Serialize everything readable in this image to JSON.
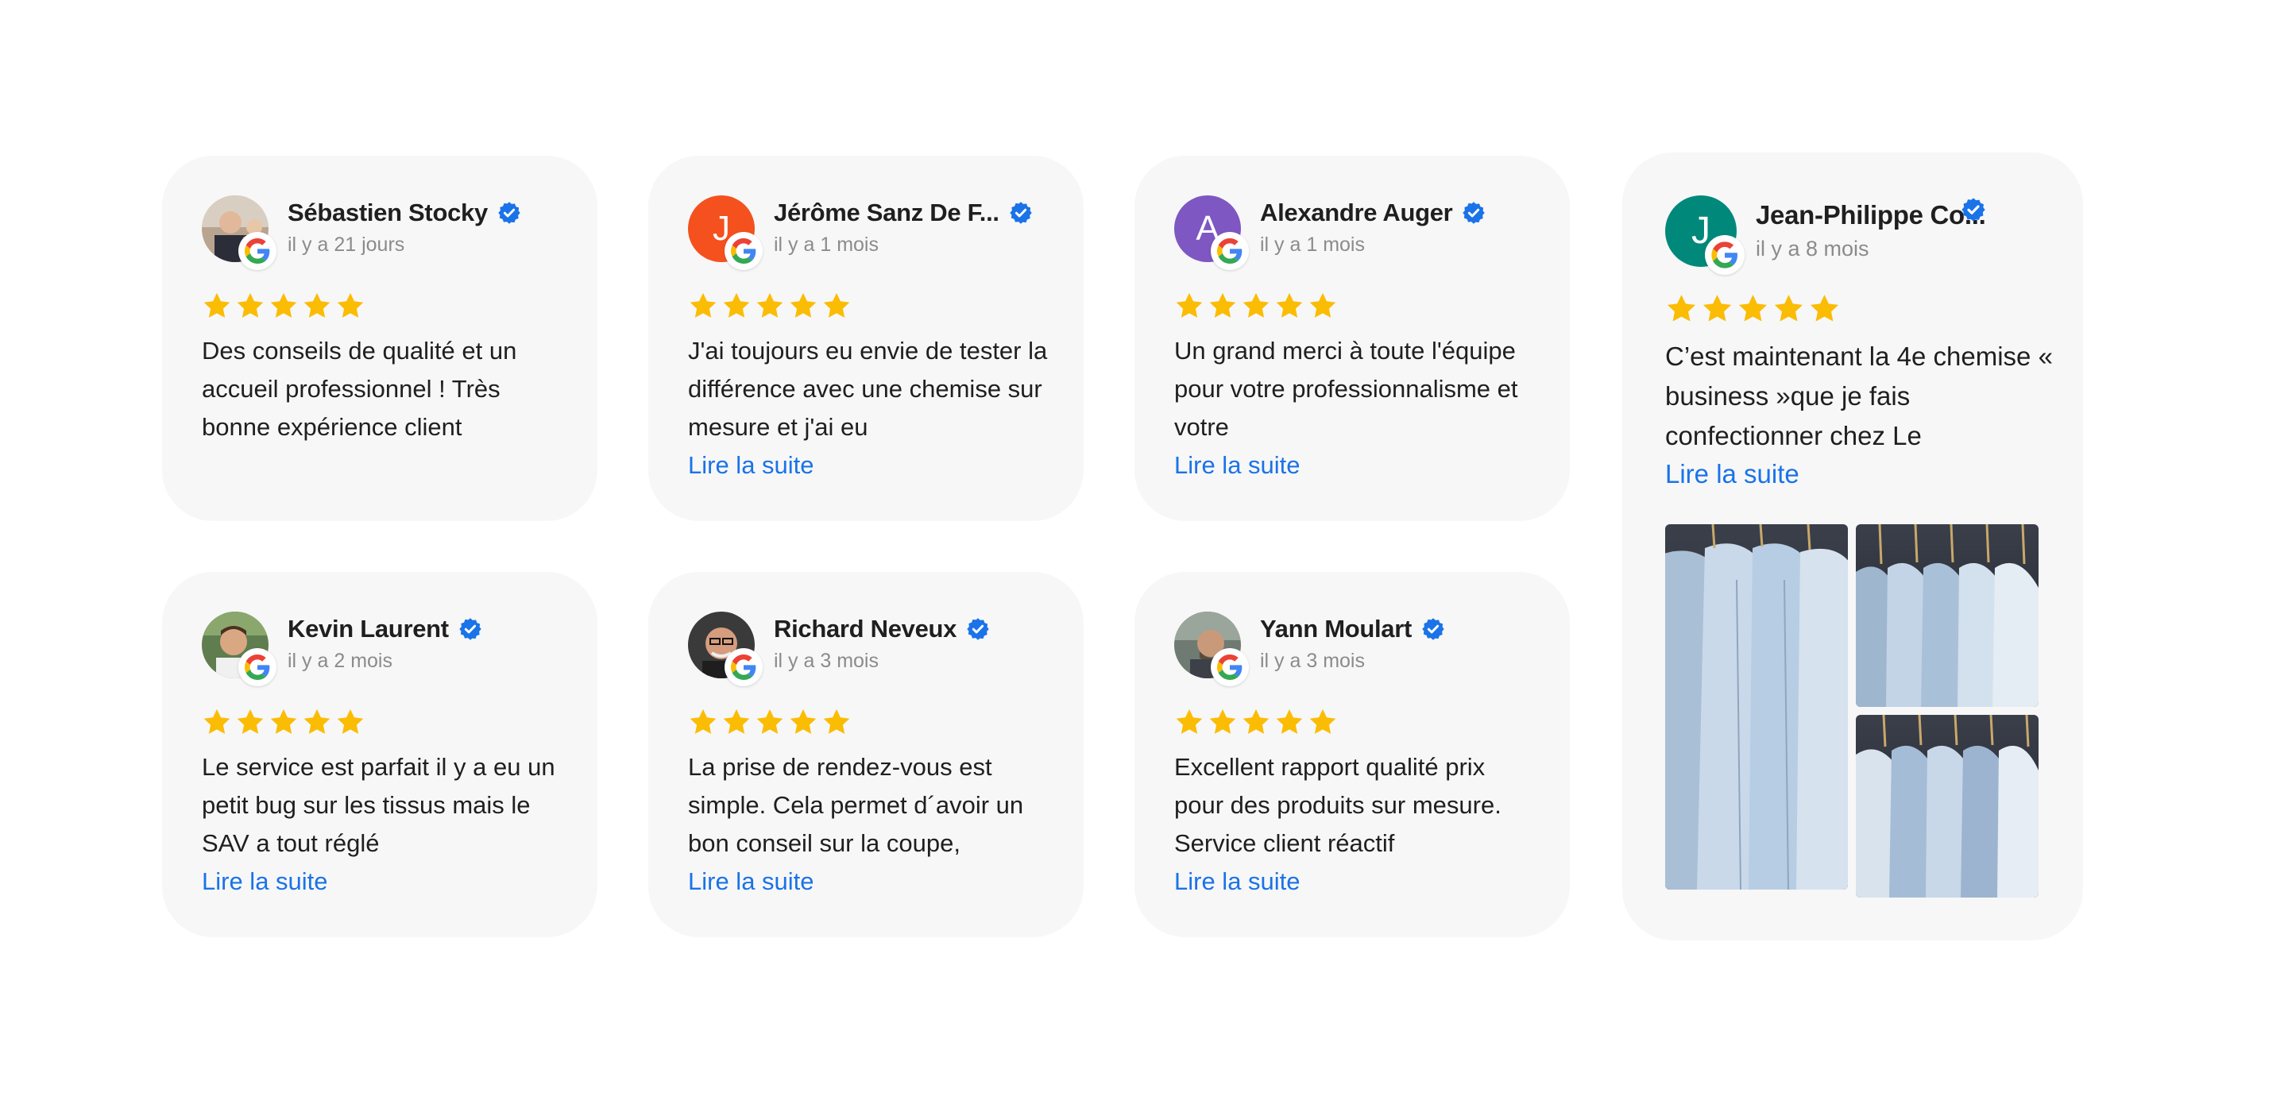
{
  "read_more_label": "Lire la suite",
  "colors": {
    "card_bg": "#f7f7f7",
    "star": "#fbbc04",
    "link": "#1a73e8",
    "verified": "#1a73e8"
  },
  "reviews": [
    {
      "name": "Sébastien Stocky",
      "date": "il y a 21 jours",
      "rating": 5,
      "avatar_initial": "",
      "avatar_type": "photo",
      "text": "Des conseils de qualité et un accueil professionnel ! Très bonne expérience client",
      "has_read_more": false
    },
    {
      "name": "Jérôme Sanz De F...",
      "date": "il y a 1 mois",
      "rating": 5,
      "avatar_initial": "J",
      "avatar_color": "#f4511e",
      "text": "J'ai toujours eu envie de tester la différence avec une chemise sur mesure et j'ai eu",
      "has_read_more": true
    },
    {
      "name": "Alexandre Auger",
      "date": "il y a 1 mois",
      "rating": 5,
      "avatar_initial": "A",
      "avatar_color": "#7e57c2",
      "text": "Un grand merci à toute l'équipe pour votre professionnalisme et votre",
      "has_read_more": true
    },
    {
      "name": "Jean-Philippe Co...",
      "date": "il y a 8 mois",
      "rating": 5,
      "avatar_initial": "J",
      "avatar_color": "#00897b",
      "text": "C’est maintenant la 4e chemise « business »que je fais confectionner chez Le",
      "has_read_more": true,
      "photos": [
        "shirts-photo-1",
        "shirts-photo-2",
        "shirts-photo-3"
      ]
    },
    {
      "name": "Kevin Laurent",
      "date": "il y a 2 mois",
      "rating": 5,
      "avatar_initial": "",
      "avatar_type": "photo",
      "text": "Le service est parfait il y a eu un petit bug sur les tissus mais le SAV a tout réglé",
      "has_read_more": true
    },
    {
      "name": "Richard Neveux",
      "date": "il y a 3 mois",
      "rating": 5,
      "avatar_initial": "",
      "avatar_type": "photo",
      "text": "La prise de rendez-vous est simple. Cela permet d´avoir un bon conseil sur la coupe,",
      "has_read_more": true
    },
    {
      "name": "Yann Moulart",
      "date": "il y a 3 mois",
      "rating": 5,
      "avatar_initial": "",
      "avatar_type": "photo",
      "text": "Excellent rapport qualité prix pour des produits sur mesure. Service client réactif",
      "has_read_more": true
    }
  ]
}
